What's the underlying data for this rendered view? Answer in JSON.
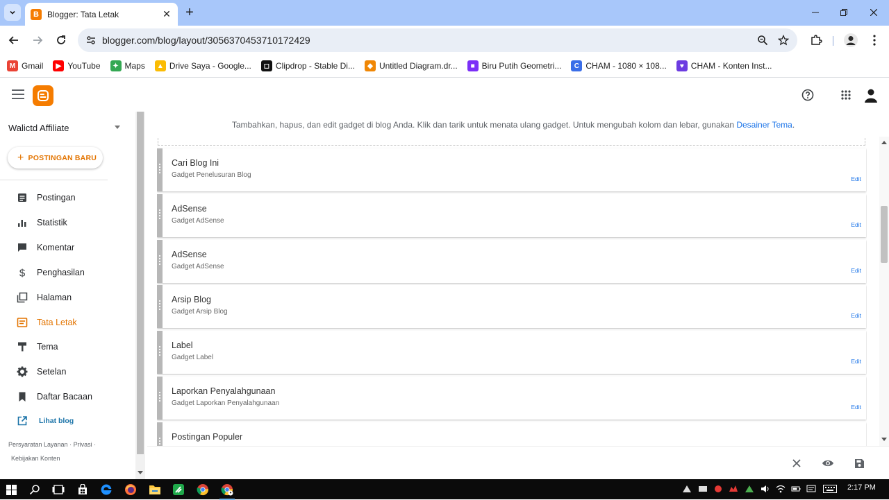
{
  "browser": {
    "tab_title": "Blogger: Tata Letak",
    "url": "blogger.com/blog/layout/3056370453710172429",
    "bookmarks": [
      {
        "label": "Gmail",
        "icon": "gmail-icon",
        "color": "#ea4335"
      },
      {
        "label": "YouTube",
        "icon": "youtube-icon",
        "color": "#ff0000"
      },
      {
        "label": "Maps",
        "icon": "maps-icon",
        "color": "#34a853"
      },
      {
        "label": "Drive Saya - Google...",
        "icon": "drive-icon",
        "color": "#fbbc04"
      },
      {
        "label": "Clipdrop - Stable Di...",
        "icon": "clipdrop-icon",
        "color": "#111111"
      },
      {
        "label": "Untitled Diagram.dr...",
        "icon": "drawio-icon",
        "color": "#f08705"
      },
      {
        "label": "Biru Putih Geometri...",
        "icon": "canva-video-icon",
        "color": "#7b2ff7"
      },
      {
        "label": "CHAM - 1080 × 108...",
        "icon": "cham-icon",
        "color": "#3a6ee8"
      },
      {
        "label": "CHAM - Konten Inst...",
        "icon": "cham-heart-icon",
        "color": "#6c3ce1"
      }
    ]
  },
  "sidebar": {
    "blog_name": "Walictd Affiliate",
    "new_post_label": "POSTINGAN BARU",
    "items": [
      {
        "label": "Postingan",
        "icon": "posts-icon"
      },
      {
        "label": "Statistik",
        "icon": "stats-icon"
      },
      {
        "label": "Komentar",
        "icon": "comment-icon"
      },
      {
        "label": "Penghasilan",
        "icon": "dollar-icon"
      },
      {
        "label": "Halaman",
        "icon": "pages-icon"
      },
      {
        "label": "Tata Letak",
        "icon": "layout-icon",
        "active": true
      },
      {
        "label": "Tema",
        "icon": "theme-icon"
      },
      {
        "label": "Setelan",
        "icon": "gear-icon"
      },
      {
        "label": "Daftar Bacaan",
        "icon": "bookmark-icon"
      }
    ],
    "view_blog": "Lihat blog",
    "footer_terms": "Persyaratan Layanan",
    "footer_privacy": "Privasi",
    "footer_policy": "Kebijakan Konten"
  },
  "main": {
    "info_text": "Tambahkan, hapus, dan edit gadget di blog Anda. Klik dan tarik untuk menata ulang gadget. Untuk mengubah kolom dan lebar, gunakan",
    "info_link": "Desainer Tema",
    "info_end": ".",
    "gadgets": [
      {
        "title": "Cari Blog Ini",
        "subtitle": "Gadget Penelusuran Blog",
        "edit": "Edit"
      },
      {
        "title": "AdSense",
        "subtitle": "Gadget AdSense",
        "edit": "Edit"
      },
      {
        "title": "AdSense",
        "subtitle": "Gadget AdSense",
        "edit": "Edit"
      },
      {
        "title": "Arsip Blog",
        "subtitle": "Gadget Arsip Blog",
        "edit": "Edit"
      },
      {
        "title": "Label",
        "subtitle": "Gadget Label",
        "edit": "Edit"
      },
      {
        "title": "Laporkan Penyalahgunaan",
        "subtitle": "Gadget Laporkan Penyalahgunaan",
        "edit": "Edit"
      },
      {
        "title": "Postingan Populer",
        "subtitle": "",
        "edit": ""
      }
    ]
  },
  "taskbar": {
    "time": "2:17 PM"
  },
  "colors": {
    "accent": "#e37400",
    "brand": "#f57c00",
    "link": "#1a73e8"
  }
}
